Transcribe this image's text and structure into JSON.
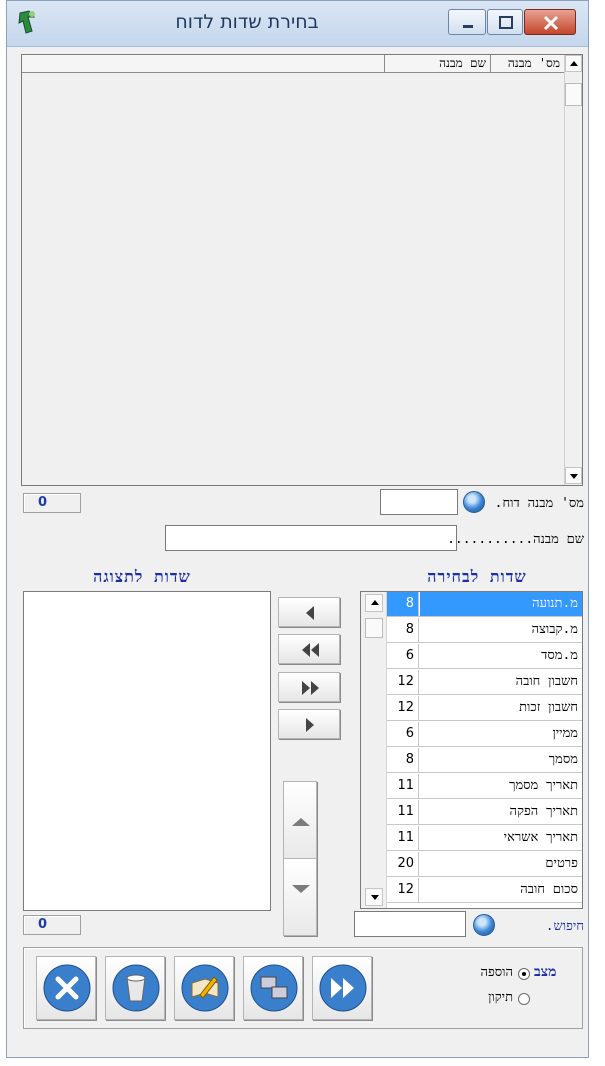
{
  "window": {
    "title": "בחירת שדות לדוח"
  },
  "structures_grid": {
    "columns": [
      "מס' מבנה",
      "שם מבנה"
    ],
    "rows": []
  },
  "top_counter": "0",
  "report_structure_no_label": "מס' מבנה דוח.",
  "report_structure_no_value": "",
  "structure_name_label": "שם מבנה...........",
  "structure_name_value": "",
  "available_fields": {
    "title": "שדות לבחירה",
    "rows": [
      {
        "name": "מ.תנועה",
        "width": "8",
        "selected": true
      },
      {
        "name": "מ.קבוצה",
        "width": "8"
      },
      {
        "name": "מ.מסד",
        "width": "6"
      },
      {
        "name": "חשבון חובה",
        "width": "12"
      },
      {
        "name": "חשבון זכות",
        "width": "12"
      },
      {
        "name": "ממיין",
        "width": "6"
      },
      {
        "name": "מסמך",
        "width": "8"
      },
      {
        "name": "תאריך מסמך",
        "width": "11"
      },
      {
        "name": "תאריך הפקה",
        "width": "11"
      },
      {
        "name": "תאריך אשראי",
        "width": "11"
      },
      {
        "name": "פרטים",
        "width": "20"
      },
      {
        "name": "סכום חובה",
        "width": "12"
      }
    ]
  },
  "display_fields": {
    "title": "שדות לתצוגה",
    "rows": []
  },
  "bottom_counter": "0",
  "search_label": "חיפוש.",
  "search_value": "",
  "mode": {
    "title": "מצב",
    "options": [
      {
        "label": "הוספה",
        "selected": true
      },
      {
        "label": "תיקון",
        "selected": false
      }
    ]
  },
  "colors": {
    "section_title": "#1d2fa8",
    "selection": "#3399ff"
  }
}
